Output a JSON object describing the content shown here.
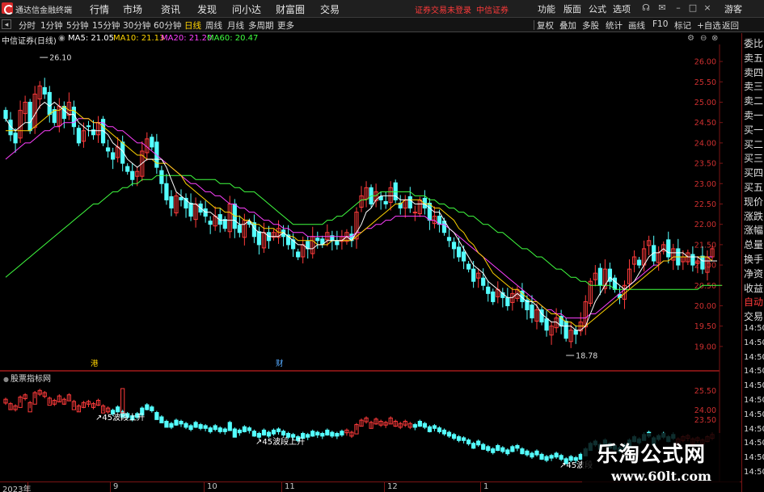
{
  "app": {
    "title": "通达信金融终端"
  },
  "menu": [
    "行情",
    "市场",
    "资讯",
    "发现",
    "问小达",
    "财富圈",
    "交易"
  ],
  "warnings": {
    "login": "证券交易未登录",
    "broker": "中信证券"
  },
  "right_menu": [
    "功能",
    "版面",
    "公式",
    "选项"
  ],
  "guest_label": "游客",
  "periods": [
    "分时",
    "1分钟",
    "5分钟",
    "15分钟",
    "30分钟",
    "60分钟",
    "日线",
    "周线",
    "月线",
    "多周期",
    "更多"
  ],
  "active_period": "日线",
  "toolbar_right": [
    "复权",
    "叠加",
    "多股",
    "统计",
    "画线",
    "F10",
    "标记",
    "+自选",
    "返回"
  ],
  "legend": {
    "title": "中信证券(日线)",
    "ma5": "MA5: 21.05",
    "ma10": "MA10: 21.13",
    "ma20": "MA20: 21.20",
    "ma60": "MA60: 20.47"
  },
  "colors": {
    "up": "#ff3b3b",
    "down": "#54ffff",
    "ma5": "#ffffff",
    "ma10": "#ffd400",
    "ma20": "#ff40ff",
    "ma60": "#40ff40",
    "axis_red": "#7a1414",
    "price_label": "#d03030"
  },
  "price_axis": [
    "26.00",
    "25.50",
    "25.00",
    "24.50",
    "24.00",
    "23.50",
    "23.00",
    "22.50",
    "22.00",
    "21.50",
    "21.00",
    "20.50",
    "20.00",
    "19.50",
    "19.00"
  ],
  "sub_axis": [
    "25.50",
    "24.00",
    "23.50"
  ],
  "annotations": {
    "high": "26.10",
    "low": "18.78",
    "badge1": "港",
    "badge2": "财"
  },
  "quote_panel": [
    "委比",
    "卖五",
    "卖四",
    "卖三",
    "卖二",
    "卖一",
    "买一",
    "买二",
    "买三",
    "买四",
    "买五",
    "现价",
    "涨跌",
    "涨幅",
    "总量",
    "换手",
    "净资",
    "收益",
    "自动",
    "交易",
    "14:50",
    "14:50",
    "14:50",
    "14:50",
    "14:50",
    "14:50",
    "14:50",
    "14:50",
    "14:50",
    "14:50",
    "14:50"
  ],
  "sub_chart": {
    "title": "股票指标网",
    "labels": [
      "45波段上升",
      "45波段上升",
      "45波段"
    ]
  },
  "x_axis": [
    "2023年",
    "9",
    "10",
    "11",
    "12",
    "1"
  ],
  "watermark": {
    "title": "乐淘公式网",
    "url": "www.60lt.com"
  },
  "chart_data": {
    "type": "candlestick",
    "title": "中信证券(日线)",
    "ylim": [
      18.6,
      26.3
    ],
    "y_ticks": [
      26.0,
      25.5,
      25.0,
      24.5,
      24.0,
      23.5,
      23.0,
      22.5,
      22.0,
      21.5,
      21.0,
      20.5,
      20.0,
      19.5,
      19.0
    ],
    "close": [
      24.6,
      24.2,
      24.0,
      24.8,
      25.0,
      24.3,
      25.2,
      25.4,
      25.2,
      24.7,
      24.5,
      24.9,
      24.6,
      25.0,
      24.4,
      24.0,
      24.3,
      24.4,
      24.2,
      24.5,
      24.0,
      23.8,
      23.6,
      23.9,
      23.5,
      23.3,
      23.1,
      23.3,
      23.8,
      24.1,
      23.9,
      23.4,
      23.0,
      22.6,
      22.4,
      22.7,
      22.6,
      22.4,
      22.2,
      22.5,
      22.3,
      22.2,
      22.0,
      22.2,
      22.0,
      21.9,
      22.5,
      21.9,
      21.8,
      22.1,
      22.0,
      21.7,
      21.5,
      21.8,
      21.6,
      21.8,
      21.9,
      21.7,
      21.5,
      21.4,
      21.2,
      21.5,
      21.4,
      21.7,
      21.6,
      21.5,
      21.8,
      21.6,
      21.5,
      21.7,
      21.8,
      21.6,
      22.3,
      22.7,
      22.9,
      22.5,
      22.8,
      22.6,
      22.5,
      22.9,
      22.6,
      22.4,
      22.6,
      22.4,
      22.3,
      22.6,
      22.4,
      22.1,
      22.2,
      22.0,
      21.8,
      21.6,
      21.4,
      21.2,
      21.1,
      20.9,
      20.6,
      20.8,
      20.5,
      20.3,
      20.1,
      20.4,
      20.2,
      20.0,
      20.3,
      20.4,
      20.1,
      19.9,
      19.7,
      19.9,
      19.6,
      19.4,
      19.5,
      19.7,
      19.5,
      19.2,
      19.4,
      19.3,
      19.6,
      20.1,
      20.6,
      20.8,
      20.5,
      20.9,
      20.6,
      20.4,
      20.2,
      20.5,
      20.9,
      21.2,
      21.0,
      21.4,
      21.6,
      21.1,
      21.3,
      21.5,
      21.2,
      21.4,
      21.0,
      21.2,
      21.3,
      21.0,
      21.1,
      20.9,
      21.2,
      21.4
    ],
    "ma5": [
      24.6,
      24.4,
      24.3,
      24.4,
      24.5,
      24.5,
      24.7,
      24.9,
      25.0,
      24.9,
      25.0,
      24.9,
      24.8,
      24.7,
      24.7,
      24.5,
      24.4,
      24.3,
      24.3,
      24.3,
      24.3,
      24.2,
      24.0,
      23.9,
      23.8,
      23.6,
      23.5,
      23.4,
      23.5,
      23.6,
      23.6,
      23.6,
      23.6,
      23.4,
      23.1,
      22.8,
      22.7,
      22.6,
      22.5,
      22.5,
      22.4,
      22.3,
      22.3,
      22.2,
      22.1,
      22.1,
      22.1,
      22.1,
      22.0,
      22.0,
      22.1,
      21.9,
      21.8,
      21.8,
      21.7,
      21.7,
      21.7,
      21.8,
      21.7,
      21.6,
      21.5,
      21.5,
      21.4,
      21.4,
      21.5,
      21.5,
      21.6,
      21.6,
      21.6,
      21.6,
      21.7,
      21.6,
      21.8,
      22.0,
      22.3,
      22.4,
      22.6,
      22.7,
      22.7,
      22.7,
      22.7,
      22.6,
      22.6,
      22.6,
      22.5,
      22.5,
      22.5,
      22.4,
      22.3,
      22.3,
      22.1,
      21.9,
      21.8,
      21.6,
      21.4,
      21.2,
      21.0,
      20.9,
      20.8,
      20.6,
      20.5,
      20.4,
      20.3,
      20.2,
      20.2,
      20.3,
      20.2,
      20.1,
      20.1,
      20.0,
      19.8,
      19.7,
      19.6,
      19.6,
      19.5,
      19.5,
      19.5,
      19.4,
      19.4,
      19.5,
      19.8,
      20.1,
      20.3,
      20.5,
      20.7,
      20.6,
      20.5,
      20.4,
      20.5,
      20.6,
      20.8,
      21.0,
      21.2,
      21.3,
      21.3,
      21.4,
      21.3,
      21.3,
      21.3,
      21.3,
      21.2,
      21.2,
      21.2,
      21.1,
      21.1,
      21.1,
      21.1
    ],
    "ma10": [
      24.3,
      24.3,
      24.3,
      24.3,
      24.3,
      24.3,
      24.4,
      24.5,
      24.6,
      24.7,
      24.8,
      24.8,
      24.9,
      24.8,
      24.8,
      24.7,
      24.6,
      24.6,
      24.5,
      24.5,
      24.4,
      24.3,
      24.2,
      24.1,
      24.0,
      23.9,
      23.8,
      23.7,
      23.7,
      23.6,
      23.6,
      23.5,
      23.5,
      23.5,
      23.4,
      23.3,
      23.2,
      23.0,
      22.9,
      22.8,
      22.7,
      22.6,
      22.5,
      22.4,
      22.4,
      22.3,
      22.3,
      22.2,
      22.2,
      22.1,
      22.1,
      22.0,
      22.0,
      21.9,
      21.9,
      21.9,
      21.8,
      21.8,
      21.7,
      21.7,
      21.6,
      21.6,
      21.6,
      21.6,
      21.5,
      21.5,
      21.5,
      21.6,
      21.6,
      21.6,
      21.6,
      21.6,
      21.7,
      21.8,
      21.9,
      22.0,
      22.1,
      22.2,
      22.3,
      22.4,
      22.5,
      22.5,
      22.6,
      22.6,
      22.6,
      22.6,
      22.5,
      22.5,
      22.4,
      22.4,
      22.3,
      22.2,
      22.1,
      21.9,
      21.8,
      21.6,
      21.5,
      21.3,
      21.2,
      21.0,
      20.8,
      20.7,
      20.6,
      20.5,
      20.4,
      20.4,
      20.3,
      20.2,
      20.1,
      20.1,
      20.0,
      19.9,
      19.8,
      19.8,
      19.7,
      19.6,
      19.6,
      19.5,
      19.5,
      19.5,
      19.6,
      19.7,
      19.8,
      19.9,
      20.0,
      20.1,
      20.2,
      20.3,
      20.4,
      20.5,
      20.6,
      20.7,
      20.8,
      20.9,
      21.0,
      21.1,
      21.1,
      21.2,
      21.2,
      21.2,
      21.2,
      21.2,
      21.2,
      21.2,
      21.2,
      21.1,
      21.1
    ],
    "ma20": [
      23.6,
      23.7,
      23.8,
      23.9,
      24.0,
      24.0,
      24.1,
      24.2,
      24.3,
      24.3,
      24.4,
      24.4,
      24.5,
      24.5,
      24.5,
      24.6,
      24.6,
      24.6,
      24.5,
      24.5,
      24.5,
      24.4,
      24.4,
      24.3,
      24.3,
      24.2,
      24.1,
      24.0,
      24.0,
      23.9,
      23.8,
      23.7,
      23.6,
      23.5,
      23.4,
      23.3,
      23.2,
      23.1,
      23.0,
      23.0,
      22.9,
      22.8,
      22.8,
      22.7,
      22.7,
      22.6,
      22.5,
      22.5,
      22.4,
      22.4,
      22.3,
      22.3,
      22.2,
      22.1,
      22.1,
      22.0,
      22.0,
      21.9,
      21.9,
      21.8,
      21.8,
      21.8,
      21.7,
      21.7,
      21.7,
      21.7,
      21.7,
      21.7,
      21.7,
      21.7,
      21.7,
      21.7,
      21.8,
      21.8,
      21.9,
      21.9,
      22.0,
      22.0,
      22.1,
      22.1,
      22.2,
      22.2,
      22.2,
      22.2,
      22.2,
      22.2,
      22.2,
      22.1,
      22.1,
      22.0,
      22.0,
      21.9,
      21.8,
      21.7,
      21.6,
      21.5,
      21.4,
      21.3,
      21.2,
      21.1,
      21.0,
      20.9,
      20.8,
      20.7,
      20.6,
      20.5,
      20.4,
      20.3,
      20.2,
      20.1,
      20.0,
      19.9,
      19.9,
      19.8,
      19.8,
      19.7,
      19.7,
      19.7,
      19.7,
      19.7,
      19.8,
      19.8,
      19.9,
      20.0,
      20.1,
      20.2,
      20.3,
      20.4,
      20.5,
      20.6,
      20.7,
      20.8,
      20.9,
      21.0,
      21.0,
      21.1,
      21.1,
      21.2,
      21.2,
      21.2,
      21.2,
      21.2,
      21.2,
      21.2,
      21.2,
      21.2
    ],
    "ma60": [
      20.7,
      20.8,
      20.9,
      21.0,
      21.1,
      21.2,
      21.3,
      21.4,
      21.5,
      21.6,
      21.7,
      21.8,
      21.9,
      22.0,
      22.1,
      22.2,
      22.3,
      22.4,
      22.5,
      22.5,
      22.6,
      22.7,
      22.8,
      22.8,
      22.9,
      22.9,
      23.0,
      23.0,
      23.1,
      23.1,
      23.1,
      23.2,
      23.2,
      23.2,
      23.2,
      23.2,
      23.2,
      23.2,
      23.2,
      23.1,
      23.1,
      23.1,
      23.1,
      23.1,
      23.0,
      23.0,
      23.0,
      22.9,
      22.9,
      22.8,
      22.8,
      22.8,
      22.7,
      22.6,
      22.5,
      22.4,
      22.3,
      22.2,
      22.1,
      22.0,
      22.0,
      22.0,
      22.0,
      22.0,
      22.0,
      22.0,
      22.1,
      22.1,
      22.2,
      22.2,
      22.3,
      22.4,
      22.5,
      22.6,
      22.6,
      22.7,
      22.7,
      22.8,
      22.8,
      22.8,
      22.8,
      22.8,
      22.8,
      22.8,
      22.7,
      22.7,
      22.7,
      22.6,
      22.6,
      22.5,
      22.5,
      22.4,
      22.4,
      22.3,
      22.3,
      22.2,
      22.2,
      22.1,
      22.0,
      22.0,
      21.9,
      21.8,
      21.8,
      21.7,
      21.6,
      21.5,
      21.4,
      21.4,
      21.3,
      21.2,
      21.2,
      21.1,
      21.0,
      20.9,
      20.9,
      20.8,
      20.7,
      20.7,
      20.6,
      20.6,
      20.5,
      20.5,
      20.5,
      20.5,
      20.5,
      20.4,
      20.4,
      20.4,
      20.4,
      20.4,
      20.4,
      20.4,
      20.4,
      20.4,
      20.4,
      20.4,
      20.4,
      20.4,
      20.4,
      20.4,
      20.4,
      20.4,
      20.4,
      20.5,
      20.5,
      20.5,
      20.5,
      20.5
    ]
  }
}
